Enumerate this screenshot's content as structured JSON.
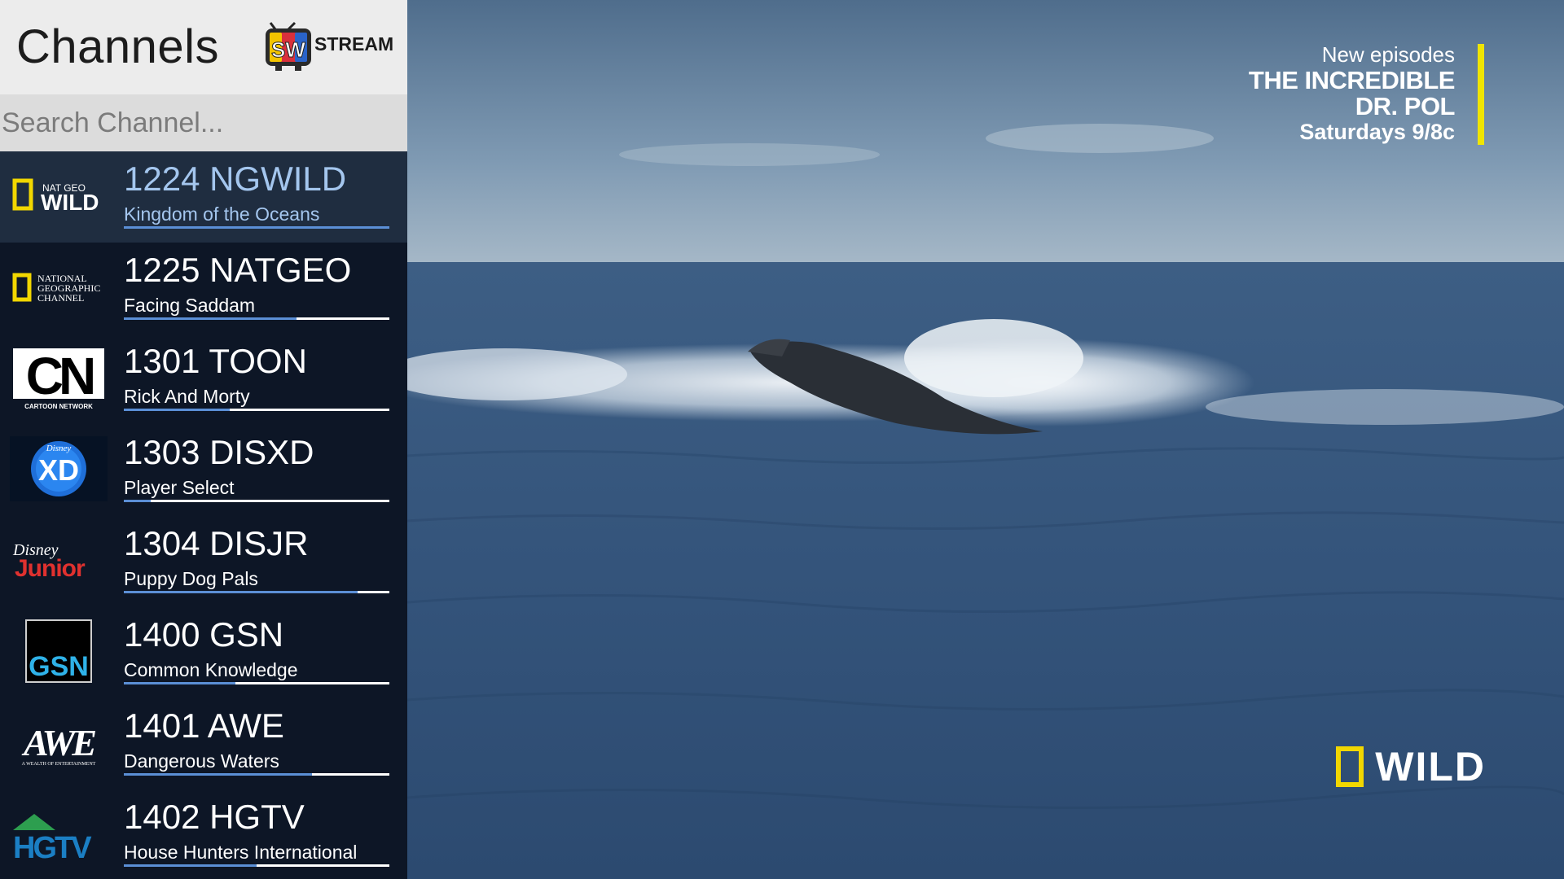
{
  "app": {
    "header_title": "Channels",
    "brand": {
      "badge": "SW",
      "wordmark": "STREAM"
    }
  },
  "search": {
    "placeholder": "Search Channel...",
    "value": ""
  },
  "channels": [
    {
      "name": "1224 NGWILD",
      "program": "Kingdom of the Oceans",
      "progress": 1.0,
      "selected": true,
      "logo": "natgeo-wild-logo",
      "logo_lines": [
        "NAT GEO",
        "WILD"
      ]
    },
    {
      "name": "1225 NATGEO",
      "program": "Facing Saddam",
      "progress": 0.65,
      "selected": false,
      "logo": "national-geographic-logo",
      "logo_lines": [
        "NATIONAL",
        "GEOGRAPHIC",
        "CHANNEL"
      ]
    },
    {
      "name": "1301 TOON",
      "program": "Rick And Morty",
      "progress": 0.4,
      "selected": false,
      "logo": "cartoon-network-logo",
      "logo_lines": [
        "CN",
        "CARTOON NETWORK"
      ]
    },
    {
      "name": "1303 DISXD",
      "program": "Player Select",
      "progress": 0.1,
      "selected": false,
      "logo": "disney-xd-logo",
      "logo_lines": [
        "Disney",
        "XD"
      ]
    },
    {
      "name": "1304 DISJR",
      "program": "Puppy Dog Pals",
      "progress": 0.88,
      "selected": false,
      "logo": "disney-junior-logo",
      "logo_lines": [
        "Disney",
        "Junior"
      ]
    },
    {
      "name": "1400 GSN",
      "program": "Common Knowledge",
      "progress": 0.42,
      "selected": false,
      "logo": "gsn-logo",
      "logo_lines": [
        "GSN"
      ]
    },
    {
      "name": "1401 AWE",
      "program": "Dangerous Waters",
      "progress": 0.71,
      "selected": false,
      "logo": "awe-logo",
      "logo_lines": [
        "AWE",
        "A WEALTH OF ENTERTAINMENT"
      ]
    },
    {
      "name": "1402 HGTV",
      "program": "House Hunters International",
      "progress": 0.5,
      "selected": false,
      "logo": "hgtv-logo",
      "logo_lines": [
        "HGTV"
      ]
    }
  ],
  "video": {
    "promo": {
      "line1": "New episodes",
      "title": "THE INCREDIBLE\nDR. POL",
      "time": "Saturdays 9/8c"
    },
    "watermark": "WILD",
    "colors": {
      "accent_yellow": "#f0e500",
      "sidebar_bg": "#0d1626",
      "selected_row": "#1f2d40",
      "progress_fill": "#5b8fd6",
      "selected_text": "#a4c6ee"
    }
  }
}
